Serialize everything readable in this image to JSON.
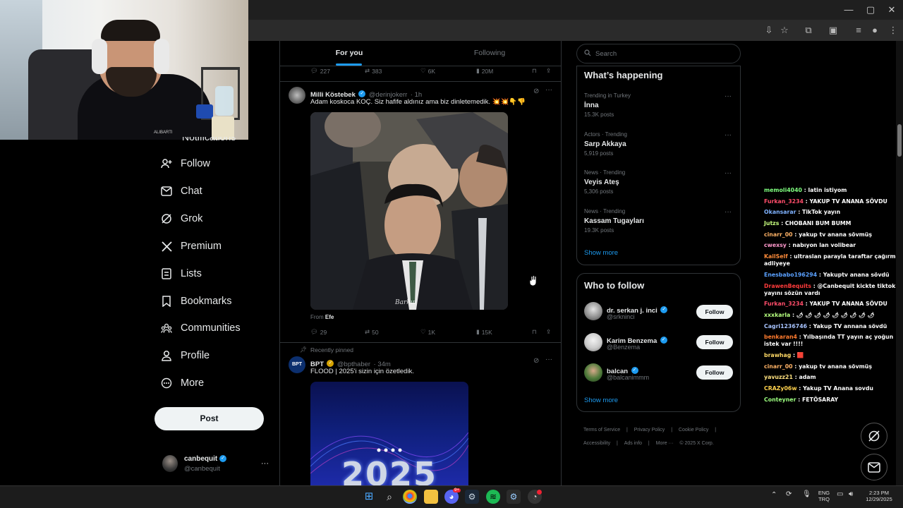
{
  "colors": {
    "accent": "#1d9bf0",
    "background": "#000000",
    "border": "#2f3336",
    "muted": "#71767b"
  },
  "webcam": {
    "shirt_text": "ALIBARTI"
  },
  "nav": {
    "partial_label": "Notifications",
    "items": [
      {
        "label": "Follow",
        "icon": "add-person-icon"
      },
      {
        "label": "Chat",
        "icon": "mail-icon"
      },
      {
        "label": "Grok",
        "icon": "grok-icon"
      },
      {
        "label": "Premium",
        "icon": "x-logo-icon"
      },
      {
        "label": "Lists",
        "icon": "lists-icon"
      },
      {
        "label": "Bookmarks",
        "icon": "bookmark-icon"
      },
      {
        "label": "Communities",
        "icon": "communities-icon"
      },
      {
        "label": "Profile",
        "icon": "profile-icon"
      },
      {
        "label": "More",
        "icon": "more-circle-icon"
      }
    ],
    "post_label": "Post",
    "account": {
      "name": "canbequit",
      "handle": "@canbequit",
      "more": "···"
    }
  },
  "feed": {
    "tabs": [
      {
        "label": "For you",
        "active": true
      },
      {
        "label": "Following",
        "active": false
      }
    ],
    "prev_actions": {
      "replies": "227",
      "reposts": "383",
      "likes": "6K",
      "views": "20M"
    },
    "tweet1": {
      "name": "Milli Köstebek",
      "handle": "@derinjokerr",
      "time": "· 1h",
      "text": "Adam koskoca KOÇ. Siz hafife aldınız ama biz dinletemedik. 💥💥👇👎",
      "media_watermark": "Barkın",
      "from_label": "From",
      "from_name": "Efe",
      "replies": "29",
      "reposts": "50",
      "likes": "1K",
      "views": "15K",
      "more": "···"
    },
    "tweet2": {
      "pinned_label": "Recently pinned",
      "name": "BPT",
      "handle": "@bpthaber",
      "time": "· 34m",
      "text": "FLOOD | 2025'i sizin için özetledik.",
      "avatar_text": "BPT",
      "media_text": "2025",
      "more": "···"
    }
  },
  "right": {
    "search_placeholder": "Search",
    "happening_title": "What’s happening",
    "trends": [
      {
        "meta": "Trending in Turkey",
        "name": "İnna",
        "posts": "15.3K posts"
      },
      {
        "meta": "Actors · Trending",
        "name": "Sarp Akkaya",
        "posts": "5,919 posts"
      },
      {
        "meta": "News · Trending",
        "name": "Veyis Ateş",
        "posts": "5,306 posts"
      },
      {
        "meta": "News · Trending",
        "name": "Kassam Tugayları",
        "posts": "19.3K posts"
      }
    ],
    "trend_more": "···",
    "show_more": "Show more",
    "wtf_title": "Who to follow",
    "wtf": [
      {
        "name": "dr. serkan j. inci",
        "handle": "@srkninci",
        "button": "Follow"
      },
      {
        "name": "Karim Benzema",
        "handle": "@Benzema",
        "button": "Follow"
      },
      {
        "name": "balcan",
        "handle": "@balcanimmm",
        "button": "Follow"
      }
    ],
    "wtf_show_more": "Show more",
    "footer": [
      "Terms of Service",
      "|",
      "Privacy Policy",
      "|",
      "Cookie Policy",
      "|",
      "Accessibility",
      "|",
      "Ads info",
      "|",
      "More ···",
      "© 2025 X Corp."
    ]
  },
  "chat": [
    {
      "user": "memoli4040",
      "color": "#7fff7f",
      "msg": ": latin istiyom"
    },
    {
      "user": "Furkan_3234",
      "color": "#ff4d6a",
      "msg": ": YAKUP TV ANANA SÖVDU"
    },
    {
      "user": "Okansarar",
      "color": "#7fb2ff",
      "msg": ": TikTok yayın"
    },
    {
      "user": "Jutzs",
      "color": "#c8ff7f",
      "msg": ": CHOBANI BUM BUMM"
    },
    {
      "user": "cinarr_00",
      "color": "#ffb266",
      "msg": ": yakup tv anana sövmüş"
    },
    {
      "user": "cwexsy",
      "color": "#ff99cc",
      "msg": ": nabıyon lan volibear"
    },
    {
      "user": "KailSelf",
      "color": "#ff8c3a",
      "msg": ": ultraslan parayla taraftar çağırmış adliyeye"
    },
    {
      "user": "Enesbabo196294",
      "color": "#5aa0ff",
      "msg": ": Yakuptv anana sövdü"
    },
    {
      "user": "DrawenBequits",
      "color": "#ff3b3b",
      "msg": ": @Canbequit kickte tiktok yayını sözün vardı"
    },
    {
      "user": "Furkan_3234",
      "color": "#ff4d6a",
      "msg": ": YAKUP TV ANANA SÖVDU"
    },
    {
      "user": "xxxkarla",
      "color": "#b6ff7f",
      "msg": ": 🌶 🌶 🌶 🌶 🌶 🌶 🌶 🌶 🌶"
    },
    {
      "user": "Cagri1236746",
      "color": "#a8c4ff",
      "msg": ": Yakup TV annana sövdü"
    },
    {
      "user": "benkaran4",
      "color": "#ff7b2e",
      "msg": ": Yılbaşında TT yayın aç yoğun istek var !!!!"
    },
    {
      "user": "brawhag",
      "color": "#ffd966",
      "msg": ": 🟥"
    },
    {
      "user": "cinarr_00",
      "color": "#ffb266",
      "msg": ": yakup tv anana sövmüş"
    },
    {
      "user": "yavuzz21",
      "color": "#ffe17f",
      "msg": ": adam"
    },
    {
      "user": "CRAZy06w",
      "color": "#ffd24d",
      "msg": ": Yakup TV Anana sovdu"
    },
    {
      "user": "Conteyner",
      "color": "#9cff7f",
      "msg": ": FETÖSARAY"
    }
  ],
  "taskbar": {
    "lang_top": "ENG",
    "lang_bottom": "TRQ",
    "time": "2:23 PM",
    "date": "12/29/2025",
    "discord_badge": "9+"
  }
}
